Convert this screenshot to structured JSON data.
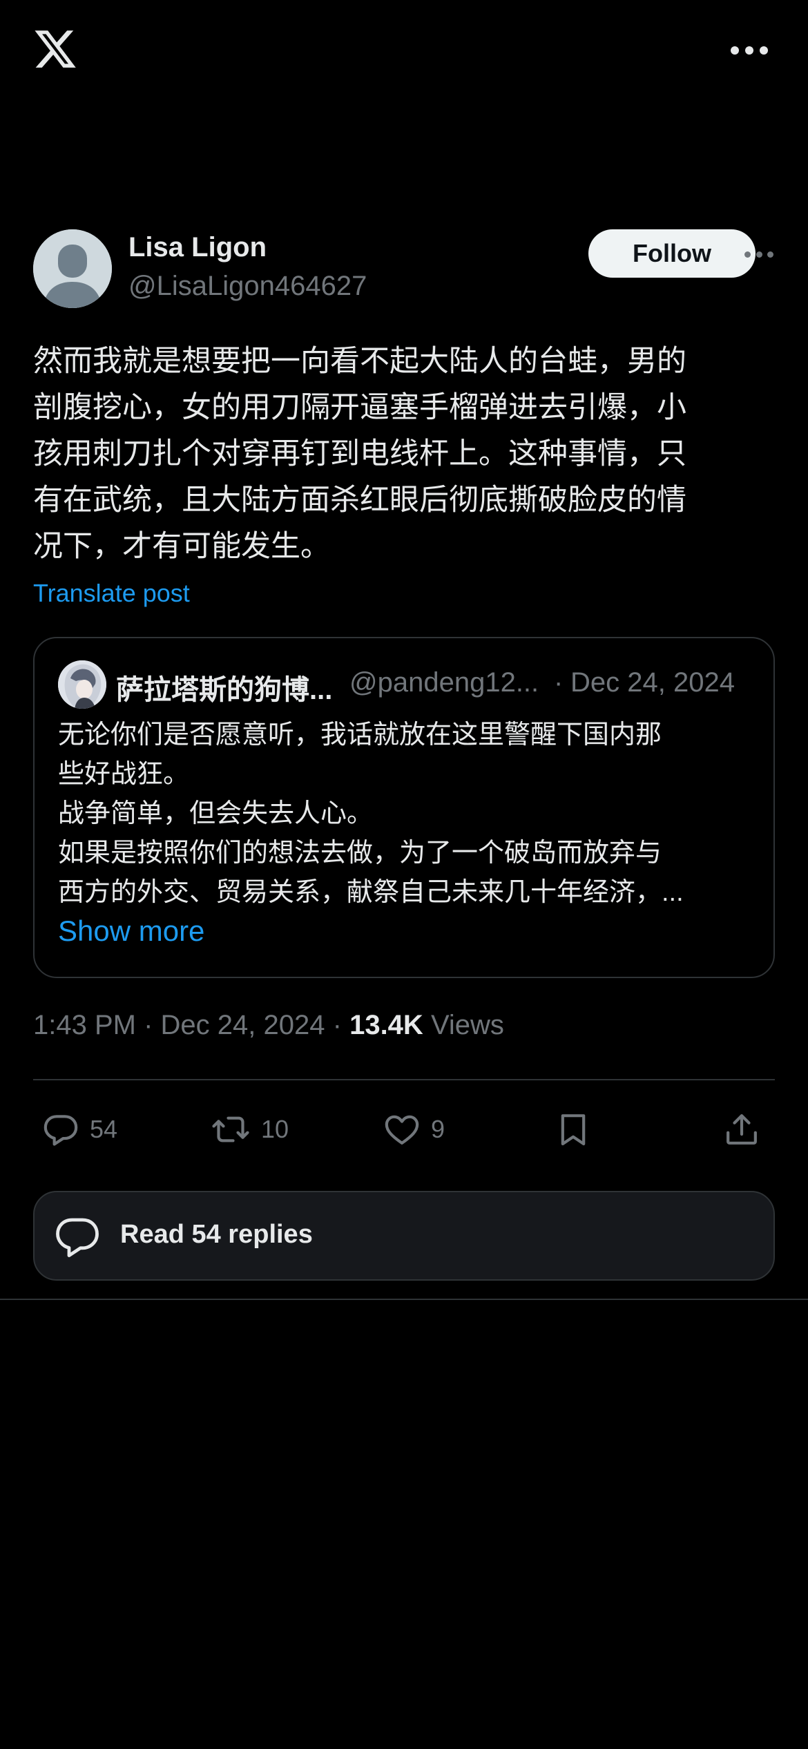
{
  "topbar": {
    "logo_icon": "x-logo-icon",
    "more_icon": "more-horizontal-icon"
  },
  "post": {
    "author": {
      "name": "Lisa Ligon",
      "handle": "@LisaLigon464627",
      "avatar_icon": "default-avatar-icon"
    },
    "follow_label": "Follow",
    "text": "然而我就是想要把一向看不起大陆人的台蛙，男的\n剖腹挖心，女的用刀隔开逼塞手榴弹进去引爆，小\n孩用刺刀扎个对穿再钉到电线杆上。这种事情，只\n有在武统，且大陆方面杀红眼后彻底撕破脸皮的情\n况下，才有可能发生。",
    "translate_label": "Translate post",
    "quote": {
      "name": "萨拉塔斯的狗博...",
      "handle": "@pandeng12...",
      "separator": "·",
      "date": "Dec 24, 2024",
      "lines": [
        "无论你们是否愿意听，我话就放在这里警醒下国内那",
        "些好战狂。",
        "战争简单，但会失去人心。",
        "如果是按照你们的想法去做，为了一个破岛而放弃与",
        "西方的外交、贸易关系，献祭自己未来几十年经济，..."
      ],
      "show_more": "Show more"
    },
    "time": "1:43 PM",
    "date": "Dec 24, 2024",
    "views_count": "13.4K",
    "views_label": "Views",
    "meta_sep": "·"
  },
  "actions": {
    "reply": {
      "icon": "reply-icon",
      "count": "54"
    },
    "repost": {
      "icon": "repost-icon",
      "count": "10"
    },
    "like": {
      "icon": "heart-icon",
      "count": "9"
    },
    "bookmark": {
      "icon": "bookmark-icon"
    },
    "share": {
      "icon": "share-icon"
    }
  },
  "read_replies": {
    "label": "Read 54 replies",
    "icon": "reply-bubble-icon"
  },
  "colors": {
    "background": "#000000",
    "text": "#e7e9ea",
    "muted": "#71767b",
    "accent": "#1d9bf0",
    "border": "#2f3336"
  }
}
